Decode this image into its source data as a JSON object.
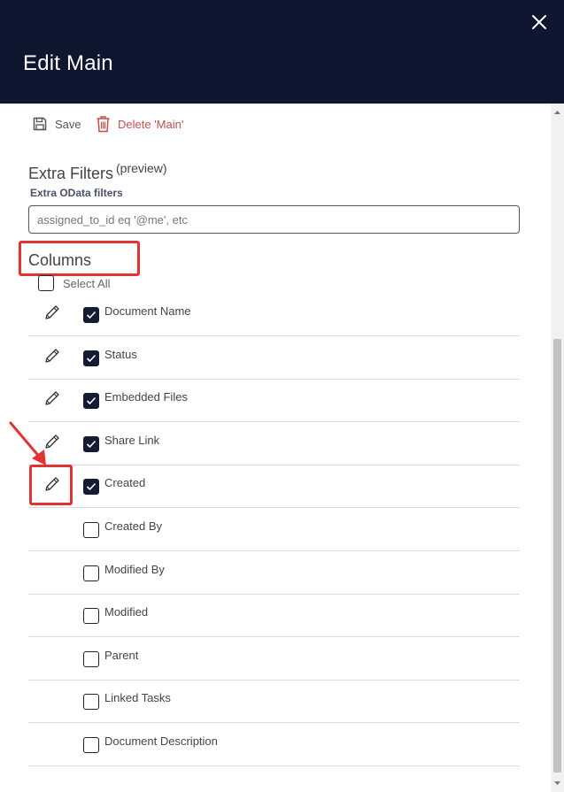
{
  "header": {
    "title": "Edit Main",
    "close_icon": "close-icon"
  },
  "toolbar": {
    "save_label": "Save",
    "delete_label": "Delete 'Main'"
  },
  "extra_filters": {
    "title": "Extra Filters",
    "preview_tag": "(preview)",
    "odata_label": "Extra OData filters",
    "odata_value": "",
    "odata_placeholder": "assigned_to_id eq '@me', etc"
  },
  "columns": {
    "title": "Columns",
    "select_all_label": "Select All",
    "select_all_checked": false,
    "items": [
      {
        "label": "Document Name",
        "checked": true,
        "editable": true
      },
      {
        "label": "Status",
        "checked": true,
        "editable": true
      },
      {
        "label": "Embedded Files",
        "checked": true,
        "editable": true
      },
      {
        "label": "Share Link",
        "checked": true,
        "editable": true
      },
      {
        "label": "Created",
        "checked": true,
        "editable": true
      },
      {
        "label": "Created By",
        "checked": false,
        "editable": false
      },
      {
        "label": "Modified By",
        "checked": false,
        "editable": false
      },
      {
        "label": "Modified",
        "checked": false,
        "editable": false
      },
      {
        "label": "Parent",
        "checked": false,
        "editable": false
      },
      {
        "label": "Linked Tasks",
        "checked": false,
        "editable": false
      },
      {
        "label": "Document Description",
        "checked": false,
        "editable": false
      }
    ]
  },
  "colors": {
    "header_bg": "#0f1730",
    "checkbox_checked": "#141b33",
    "delete_red": "#c0504d",
    "annotation_red": "#e03333"
  }
}
